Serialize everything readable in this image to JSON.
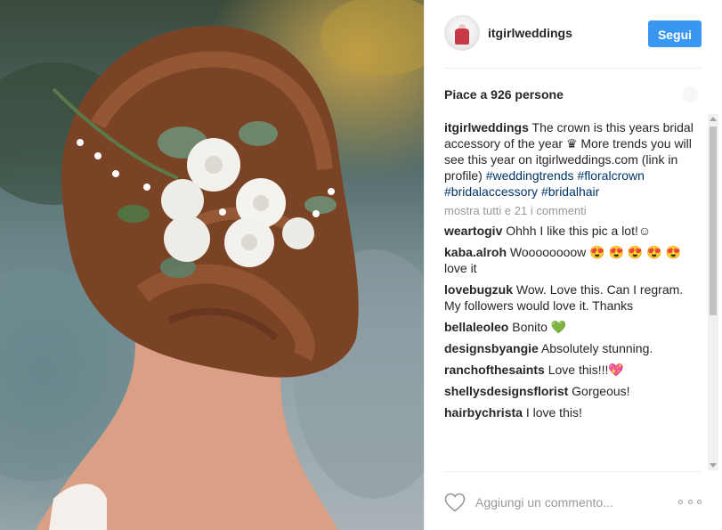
{
  "header": {
    "username": "itgirlweddings",
    "follow_label": "Segui"
  },
  "likes_text": "Piace a 926 persone",
  "caption": {
    "username": "itgirlweddings",
    "text": "The crown is this years bridal accessory of the year ♛ More trends you will see this year on itgirlweddings.com (link in profile)",
    "tags": [
      "#weddingtrends",
      "#floralcrown",
      "#bridalaccessory",
      "#bridalhair"
    ]
  },
  "view_all_comments": "mostra tutti e 21 i commenti",
  "comments": [
    {
      "username": "weartogiv",
      "text": "Ohhh I like this pic a lot!☺"
    },
    {
      "username": "kaba.alroh",
      "text": "Woooooooow 😍 😍 😍 😍 😍 love it"
    },
    {
      "username": "lovebugzuk",
      "text": "Wow. Love this. Can I regram. My followers would love it. Thanks"
    },
    {
      "username": "bellaleoleo",
      "text": "Bonito 💚"
    },
    {
      "username": "designsbyangie",
      "text": "Absolutely stunning."
    },
    {
      "username": "ranchofthesaints",
      "text": "Love this!!!💖"
    },
    {
      "username": "shellysdesignsflorist",
      "text": "Gorgeous!"
    },
    {
      "username": "hairbychrista",
      "text": "I love this!"
    }
  ],
  "footer": {
    "comment_placeholder": "Aggiungi un commento...",
    "like_icon": "heart-outline-icon",
    "more_icon": "more-options-icon"
  },
  "colors": {
    "follow_button": "#3897f0",
    "hashtag": "#003569",
    "muted": "#999999",
    "text": "#262626"
  }
}
